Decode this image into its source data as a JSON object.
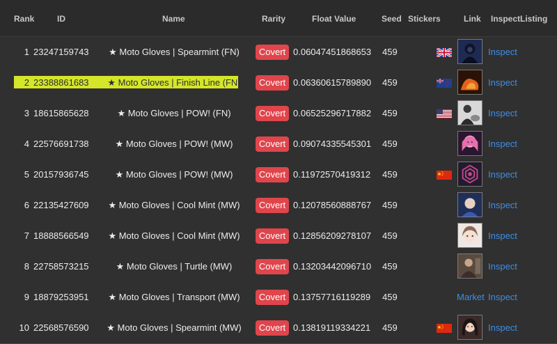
{
  "columns": {
    "rank": "Rank",
    "id": "ID",
    "name": "Name",
    "rarity": "Rarity",
    "float": "Float Value",
    "seed": "Seed",
    "stickers": "Stickers",
    "link": "Link",
    "inspect": "Inspect",
    "listing": "Listing"
  },
  "rows": [
    {
      "rank": "1",
      "id": "23247159743",
      "name": "★ Moto Gloves | Spearmint (FN)",
      "rarity": "Covert",
      "float": "0.06047451868653",
      "seed": "459",
      "flag": "uk-flag",
      "link_type": "thumbnail",
      "thumb_icon": "dark-hooded-figure-avatar",
      "inspect": "Inspect",
      "highlighted": false
    },
    {
      "rank": "2",
      "id": "23388861683",
      "name": "★ Moto Gloves | Finish Line (FN)",
      "rarity": "Covert",
      "float": "0.06360615789890",
      "seed": "459",
      "flag": "new-zealand-flag",
      "link_type": "thumbnail",
      "thumb_icon": "orange-fire-avatar",
      "inspect": "Inspect",
      "highlighted": true
    },
    {
      "rank": "3",
      "id": "18615865628",
      "name": "★ Moto Gloves | POW! (FN)",
      "rarity": "Covert",
      "float": "0.06525296717882",
      "seed": "459",
      "flag": "usa-flag",
      "link_type": "thumbnail",
      "thumb_icon": "figure-with-dog-avatar",
      "inspect": "Inspect",
      "highlighted": false
    },
    {
      "rank": "4",
      "id": "22576691738",
      "name": "★ Moto Gloves | POW! (MW)",
      "rarity": "Covert",
      "float": "0.09074335545301",
      "seed": "459",
      "flag": "",
      "link_type": "thumbnail",
      "thumb_icon": "pink-anime-girl-avatar",
      "inspect": "Inspect",
      "highlighted": false
    },
    {
      "rank": "5",
      "id": "20157936745",
      "name": "★ Moto Gloves | POW! (MW)",
      "rarity": "Covert",
      "float": "0.11972570419312",
      "seed": "459",
      "flag": "china-flag",
      "link_type": "thumbnail",
      "thumb_icon": "purple-hexagon-logo-avatar",
      "inspect": "Inspect",
      "highlighted": false
    },
    {
      "rank": "6",
      "id": "22135427609",
      "name": "★ Moto Gloves | Cool Mint (MW)",
      "rarity": "Covert",
      "float": "0.12078560888767",
      "seed": "459",
      "flag": "",
      "link_type": "thumbnail",
      "thumb_icon": "blue-anime-character-avatar",
      "inspect": "Inspect",
      "highlighted": false
    },
    {
      "rank": "7",
      "id": "18888566549",
      "name": "★ Moto Gloves | Cool Mint (MW)",
      "rarity": "Covert",
      "float": "0.12856209278107",
      "seed": "459",
      "flag": "",
      "link_type": "thumbnail",
      "thumb_icon": "anime-girl-face-avatar",
      "inspect": "Inspect",
      "highlighted": false
    },
    {
      "rank": "8",
      "id": "22758573215",
      "name": "★ Moto Gloves | Turtle (MW)",
      "rarity": "Covert",
      "float": "0.13203442096710",
      "seed": "459",
      "flag": "",
      "link_type": "thumbnail",
      "thumb_icon": "photo-person-avatar",
      "inspect": "Inspect",
      "highlighted": false
    },
    {
      "rank": "9",
      "id": "18879253951",
      "name": "★ Moto Gloves | Transport (MW)",
      "rarity": "Covert",
      "float": "0.13757716119289",
      "seed": "459",
      "flag": "",
      "link_type": "market",
      "market": "Market",
      "inspect": "Inspect",
      "highlighted": false
    },
    {
      "rank": "10",
      "id": "22568576590",
      "name": "★ Moto Gloves | Spearmint (MW)",
      "rarity": "Covert",
      "float": "0.13819119334221",
      "seed": "459",
      "flag": "china-flag",
      "link_type": "thumbnail",
      "thumb_icon": "woman-portrait-avatar",
      "inspect": "Inspect",
      "highlighted": false
    }
  ],
  "colors": {
    "background": "#303030",
    "rarity_badge": "#e0454c",
    "link": "#3d8ee6",
    "highlight": "#d5e62a"
  }
}
